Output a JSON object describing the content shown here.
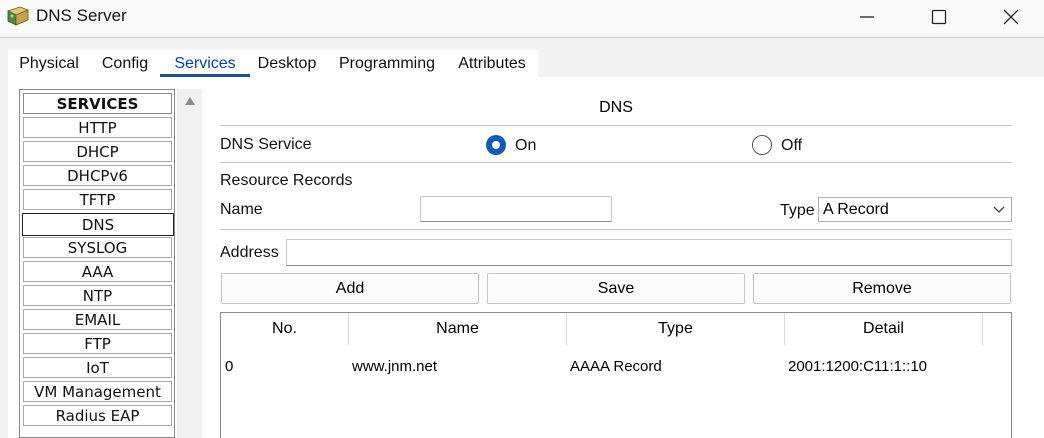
{
  "window": {
    "title": "DNS Server",
    "minimize_label": "",
    "maximize_label": "",
    "close_label": ""
  },
  "tabs": [
    {
      "label": "Physical"
    },
    {
      "label": "Config"
    },
    {
      "label": "Services",
      "active": true
    },
    {
      "label": "Desktop"
    },
    {
      "label": "Programming"
    },
    {
      "label": "Attributes"
    }
  ],
  "services": {
    "header": "SERVICES",
    "items": [
      "HTTP",
      "DHCP",
      "DHCPv6",
      "TFTP",
      "DNS",
      "SYSLOG",
      "AAA",
      "NTP",
      "EMAIL",
      "FTP",
      "IoT",
      "VM Management",
      "Radius EAP"
    ],
    "selected": "DNS"
  },
  "dns": {
    "title": "DNS",
    "service_label": "DNS Service",
    "on_label": "On",
    "off_label": "Off",
    "service_state": "On",
    "resource_records_label": "Resource Records",
    "name_label": "Name",
    "name_value": "",
    "type_label": "Type",
    "type_value": "A Record",
    "address_label": "Address",
    "address_value": "",
    "add_label": "Add",
    "save_label": "Save",
    "remove_label": "Remove"
  },
  "records_table": {
    "columns": [
      "No.",
      "Name",
      "Type",
      "Detail"
    ],
    "rows": [
      {
        "no": "0",
        "name": "www.jnm.net",
        "type": "AAAA Record",
        "detail": "2001:1200:C11:1::10"
      }
    ]
  },
  "colors": {
    "accent": "#0a5bbd",
    "active_tab_text": "#0044aa",
    "active_tab_underline": "#1a4fa0"
  }
}
